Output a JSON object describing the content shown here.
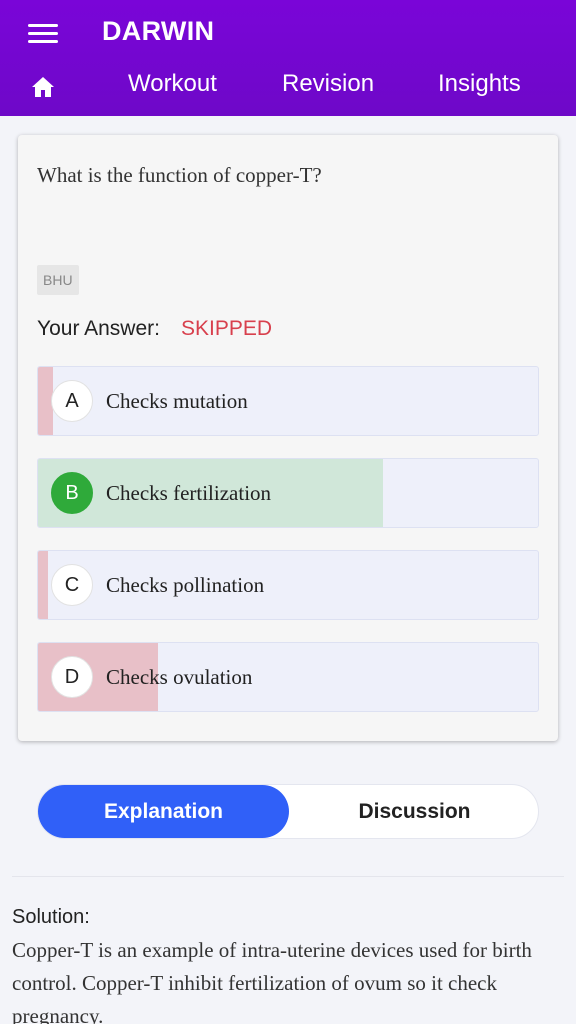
{
  "header": {
    "title": "DARWIN",
    "nav": [
      "Workout",
      "Revision",
      "Insights"
    ]
  },
  "question": {
    "text": "What is the function of copper-T?",
    "tag": "BHU",
    "answer_label": "Your Answer:",
    "answer_value": "SKIPPED"
  },
  "options": [
    {
      "letter": "A",
      "text": "Checks mutation",
      "percent": 3,
      "correct": false
    },
    {
      "letter": "B",
      "text": "Checks fertilization",
      "percent": 69,
      "correct": true
    },
    {
      "letter": "C",
      "text": "Checks pollination",
      "percent": 2,
      "correct": false
    },
    {
      "letter": "D",
      "text": "Checks ovulation",
      "percent": 24,
      "correct": false
    }
  ],
  "tabs": {
    "explanation": "Explanation",
    "discussion": "Discussion"
  },
  "solution": {
    "label": "Solution:",
    "text": "Copper-T is an example of intra-uterine devices used for birth control. Copper-T inhibit fertilization of ovum so it check pregnancy."
  },
  "colors": {
    "header": "#7a05d8",
    "correct_fill": "#d0e7d9",
    "incorrect_fill": "#e8c0c8",
    "correct_badge": "#2faa3a",
    "skipped": "#d8404d",
    "active_tab": "#3060f8"
  },
  "icons": {
    "menu": "menu-icon",
    "home": "home-icon"
  }
}
